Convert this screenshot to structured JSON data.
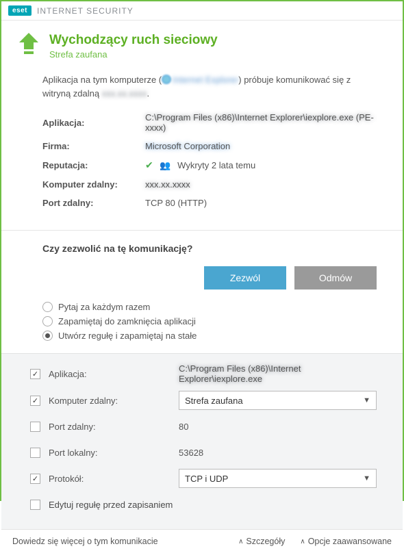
{
  "brand": {
    "badge": "eset",
    "title": "INTERNET SECURITY"
  },
  "header": {
    "title": "Wychodzący ruch sieciowy",
    "subtitle": "Strefa zaufana"
  },
  "intro": {
    "prefix": "Aplikacja na tym komputerze ",
    "app_blur": "Internet Explorer",
    "middle": " próbuje komunikować się z witryną zdalną ",
    "target_blur": "xxx.xx.xxxx"
  },
  "info": {
    "app_label": "Aplikacja:",
    "app_value_blur": "C:\\Program Files (x86)\\Internet Explorer\\iexplore.exe (PE-xxxx)",
    "company_label": "Firma:",
    "company_value_blur": "Microsoft Corporation",
    "reputation_label": "Reputacja:",
    "reputation_value": "Wykryty 2 lata temu",
    "remote_label": "Komputer zdalny:",
    "remote_value_blur": "xxx.xx.xxxx",
    "rport_label": "Port zdalny:",
    "rport_value": "TCP 80 (HTTP)"
  },
  "question": {
    "title": "Czy zezwolić na tę komunikację?",
    "allow": "Zezwól",
    "deny": "Odmów",
    "radios": {
      "ask": "Pytaj za każdym razem",
      "until_close": "Zapamiętaj do zamknięcia aplikacji",
      "create_rule": "Utwórz regułę i zapamiętaj na stałe"
    },
    "selected_radio": "create_rule"
  },
  "rule": {
    "app": {
      "checked": true,
      "label": "Aplikacja:",
      "value_blur": "C:\\Program Files (x86)\\Internet Explorer\\iexplore.exe"
    },
    "remote": {
      "checked": true,
      "label": "Komputer zdalny:",
      "value": "Strefa zaufana"
    },
    "rport": {
      "checked": false,
      "label": "Port zdalny:",
      "value": "80"
    },
    "lport": {
      "checked": false,
      "label": "Port lokalny:",
      "value": "53628"
    },
    "proto": {
      "checked": true,
      "label": "Protokół:",
      "value": "TCP i UDP"
    },
    "edit_before_save": {
      "checked": false,
      "label": "Edytuj regułę przed zapisaniem"
    }
  },
  "footer": {
    "learn_more": "Dowiedz się więcej o tym komunikacie",
    "details": "Szczegóły",
    "advanced": "Opcje zaawansowane"
  }
}
